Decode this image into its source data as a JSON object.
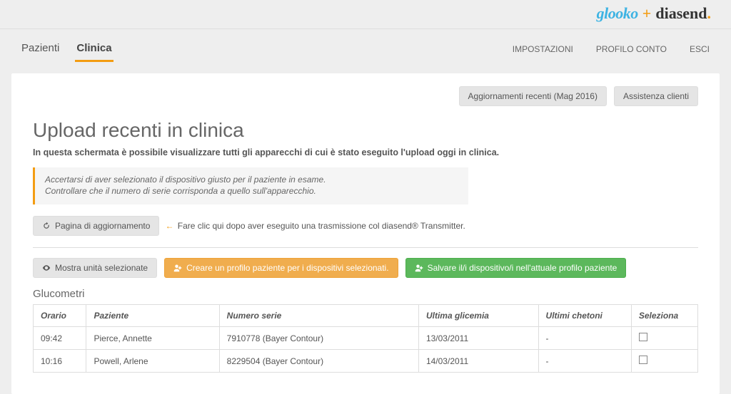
{
  "logo": {
    "glooko": "glooko",
    "plus": "+",
    "diasend": "diasend",
    "dot": "."
  },
  "nav": {
    "pazienti": "Pazienti",
    "clinica": "Clinica",
    "impostazioni": "IMPOSTAZIONI",
    "profilo": "PROFILO CONTO",
    "esci": "ESCI"
  },
  "subnav": {
    "aggiornamenti": "Aggiornamenti recenti (Mag 2016)",
    "assistenza": "Assistenza clienti"
  },
  "page": {
    "title": "Upload recenti in clinica",
    "subtitle": "In questa schermata è possibile visualizzare tutti gli apparecchi di cui è stato eseguito l'upload oggi in clinica.",
    "alert_line1": "Accertarsi di aver selezionato il dispositivo giusto per il paziente in esame.",
    "alert_line2": "Controllare che il numero di serie corrisponda a quello sull'apparecchio.",
    "refresh_label": "Pagina di aggiornamento",
    "refresh_hint": "Fare clic qui dopo aver eseguito una trasmissione col diasend® Transmitter."
  },
  "actions": {
    "mostra": "Mostra unità selezionate",
    "creare": "Creare un profilo paziente per i dispositivi selezionati.",
    "salvare": "Salvare il/i dispositivo/i nell'attuale profilo paziente"
  },
  "table": {
    "title": "Glucometri",
    "headers": {
      "orario": "Orario",
      "paziente": "Paziente",
      "serie": "Numero serie",
      "glicemia": "Ultima glicemia",
      "chetoni": "Ultimi chetoni",
      "seleziona": "Seleziona"
    },
    "rows": [
      {
        "orario": "09:42",
        "paziente": "Pierce, Annette",
        "serie": "7910778 (Bayer Contour)",
        "glicemia": "13/03/2011",
        "chetoni": "-"
      },
      {
        "orario": "10:16",
        "paziente": "Powell, Arlene",
        "serie": "8229504 (Bayer Contour)",
        "glicemia": "14/03/2011",
        "chetoni": "-"
      }
    ]
  }
}
